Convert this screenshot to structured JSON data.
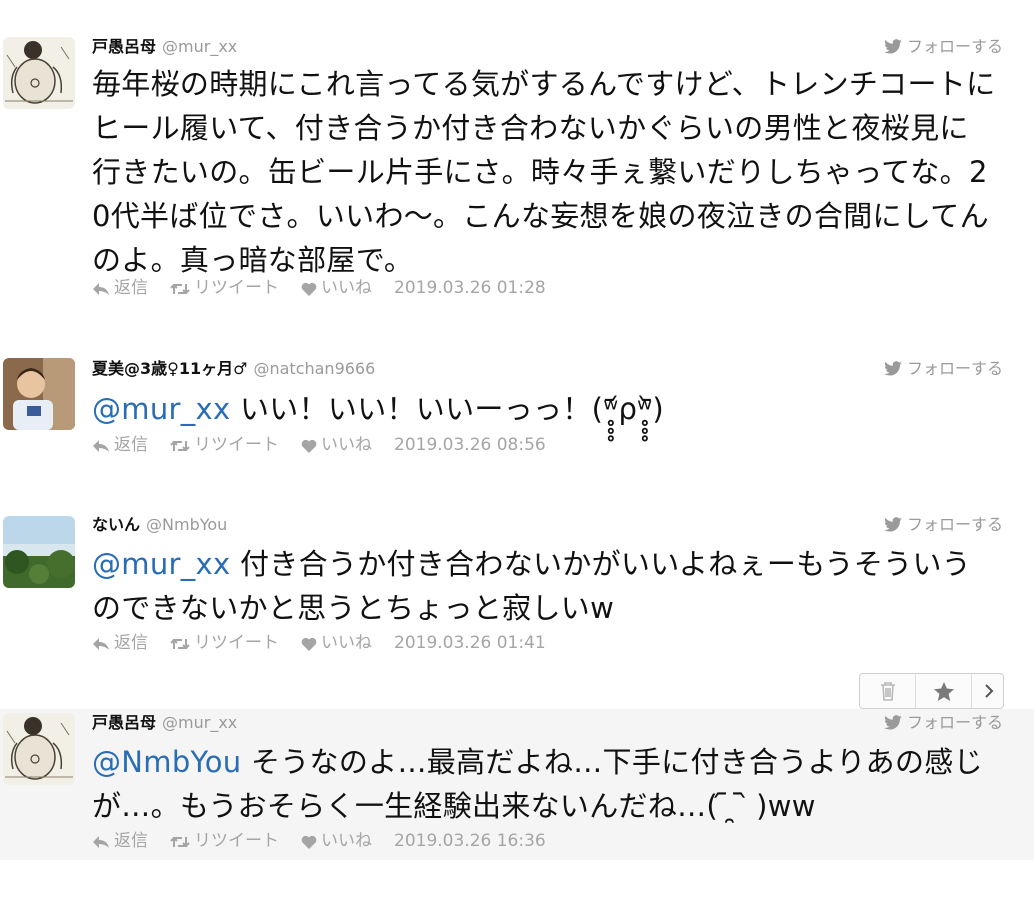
{
  "actions": {
    "reply": "返信",
    "retweet": "リツイート",
    "like": "いいね",
    "follow": "フォローする"
  },
  "colors": {
    "mention": "#2a6db5",
    "muted": "#9a9a9a",
    "highlight_bg": "#f5f5f5"
  },
  "tweets": [
    {
      "display_name": "戸愚呂母",
      "handle": "@mur_xx",
      "avatar": "drawing-avatar",
      "mention": "",
      "text": "毎年桜の時期にこれ言ってる気がするんですけど、トレンチコートにヒール履いて、付き合うか付き合わないかぐらいの男性と夜桜見に行きたいの。缶ビール片手にさ。時々手ぇ繋いだりしちゃってな。20代半ば位でさ。いいわ〜。こんな妄想を娘の夜泣きの合間にしてんのよ。真っ暗な部屋で。",
      "timestamp": "2019.03.26 01:28"
    },
    {
      "display_name": "夏美@3歳♀11ヶ月♂",
      "handle": "@natchan9666",
      "avatar": "child-photo-avatar",
      "mention": "@mur_xx",
      "text": " いい！いい！いいーっっ！(ʷ̥̥̥᷄ρʷ̥̥̥᷅)",
      "timestamp": "2019.03.26 08:56"
    },
    {
      "display_name": "ないん",
      "handle": "@NmbYou",
      "avatar": "landscape-avatar",
      "mention": "@mur_xx",
      "text": " 付き合うか付き合わないかがいいよねぇーもうそういうのできないかと思うとちょっと寂しいw",
      "timestamp": "2019.03.26 01:41"
    },
    {
      "display_name": "戸愚呂母",
      "handle": "@mur_xx",
      "avatar": "drawing-avatar",
      "mention": "@NmbYou",
      "text": " そうなのよ…最高だよね…下手に付き合うよりあの感じが…。もうおそらく一生経験出来ないんだね…( ᷇ ̯ ᷆ )ww",
      "timestamp": "2019.03.26 16:36"
    }
  ]
}
